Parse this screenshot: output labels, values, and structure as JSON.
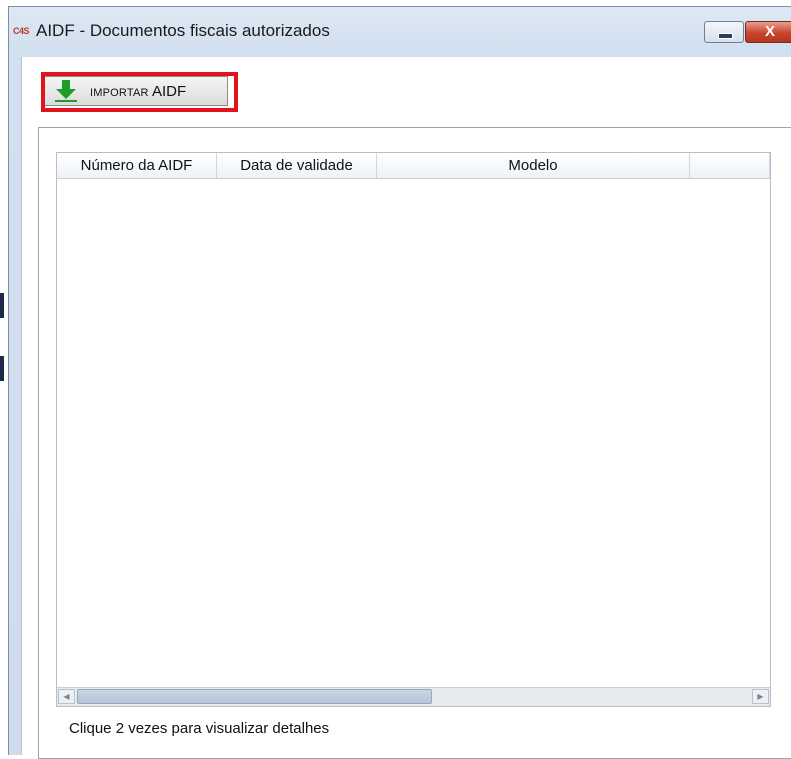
{
  "window": {
    "app_icon_text": "C4S",
    "title": "AIDF - Documentos fiscais autorizados",
    "minimize_label": "",
    "close_label": "X"
  },
  "toolbar": {
    "import_button": {
      "prefix": "IMPORTAR",
      "suffix": "AIDF",
      "icon": "download-arrow-icon"
    }
  },
  "table": {
    "columns": [
      "Número da AIDF",
      "Data de validade",
      "Modelo",
      ""
    ],
    "rows": []
  },
  "footer": {
    "hint": "Clique 2 vezes para visualizar detalhes"
  },
  "colors": {
    "highlight": "#e2141b",
    "icon_green": "#1f9d2b"
  }
}
